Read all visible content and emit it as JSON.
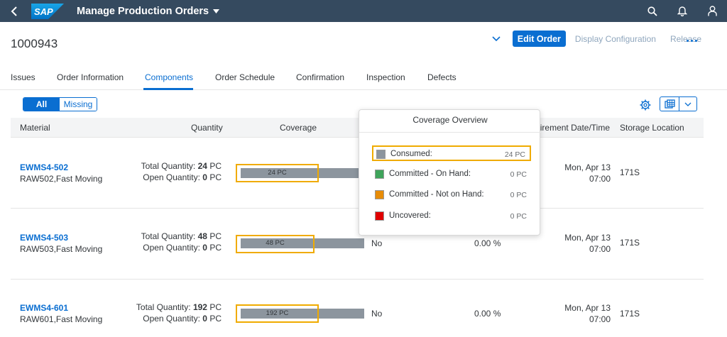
{
  "shell": {
    "logo_text": "SAP",
    "title": "Manage Production Orders"
  },
  "header": {
    "object_id": "1000943",
    "actions": {
      "edit": "Edit Order",
      "display_config": "Display Configuration",
      "release": "Release"
    }
  },
  "tabs": [
    {
      "label": "Issues"
    },
    {
      "label": "Order Information"
    },
    {
      "label": "Components"
    },
    {
      "label": "Order Schedule"
    },
    {
      "label": "Confirmation"
    },
    {
      "label": "Inspection"
    },
    {
      "label": "Defects"
    }
  ],
  "active_tab": "Components",
  "filter": {
    "all": "All",
    "missing": "Missing"
  },
  "columns": {
    "material": "Material",
    "quantity": "Quantity",
    "coverage": "Coverage",
    "requirement_date": "Requirement Date/Time",
    "storage_location": "Storage Location"
  },
  "rows": [
    {
      "material_id": "EWMS4-502",
      "material_desc": "RAW502,Fast Moving",
      "total_label": "Total Quantity:",
      "total_value": "24",
      "total_unit": "PC",
      "open_label": "Open Quantity:",
      "open_value": "0",
      "open_unit": "PC",
      "coverage_label": "24 PC",
      "coverage_fraction": 1.0,
      "backflush": "",
      "percent": "",
      "date": "Mon, Apr 13",
      "time": "07:00",
      "storage": "171S"
    },
    {
      "material_id": "EWMS4-503",
      "material_desc": "RAW503,Fast Moving",
      "total_label": "Total Quantity:",
      "total_value": "48",
      "total_unit": "PC",
      "open_label": "Open Quantity:",
      "open_value": "0",
      "open_unit": "PC",
      "coverage_label": "48 PC",
      "coverage_fraction": 1.0,
      "backflush": "No",
      "percent": "0.00 %",
      "date": "Mon, Apr 13",
      "time": "07:00",
      "storage": "171S"
    },
    {
      "material_id": "EWMS4-601",
      "material_desc": "RAW601,Fast Moving",
      "total_label": "Total Quantity:",
      "total_value": "192",
      "total_unit": "PC",
      "open_label": "Open Quantity:",
      "open_value": "0",
      "open_unit": "PC",
      "coverage_label": "192 PC",
      "coverage_fraction": 1.0,
      "backflush": "No",
      "percent": "0.00 %",
      "date": "Mon, Apr 13",
      "time": "07:00",
      "storage": "171S"
    }
  ],
  "popover": {
    "title": "Coverage Overview",
    "items": [
      {
        "label": "Consumed:",
        "value": "24 PC",
        "color": "#8c959e"
      },
      {
        "label": "Committed - On Hand:",
        "value": "0 PC",
        "color": "#3fa45b"
      },
      {
        "label": "Committed - Not on Hand:",
        "value": "0 PC",
        "color": "#e78c07"
      },
      {
        "label": "Uncovered:",
        "value": "0 PC",
        "color": "#e00000"
      }
    ]
  },
  "colors": {
    "shell": "#354a5f",
    "accent": "#0a6ed1",
    "highlight": "#f0ab00",
    "coverage_bar": "#8c959e"
  }
}
